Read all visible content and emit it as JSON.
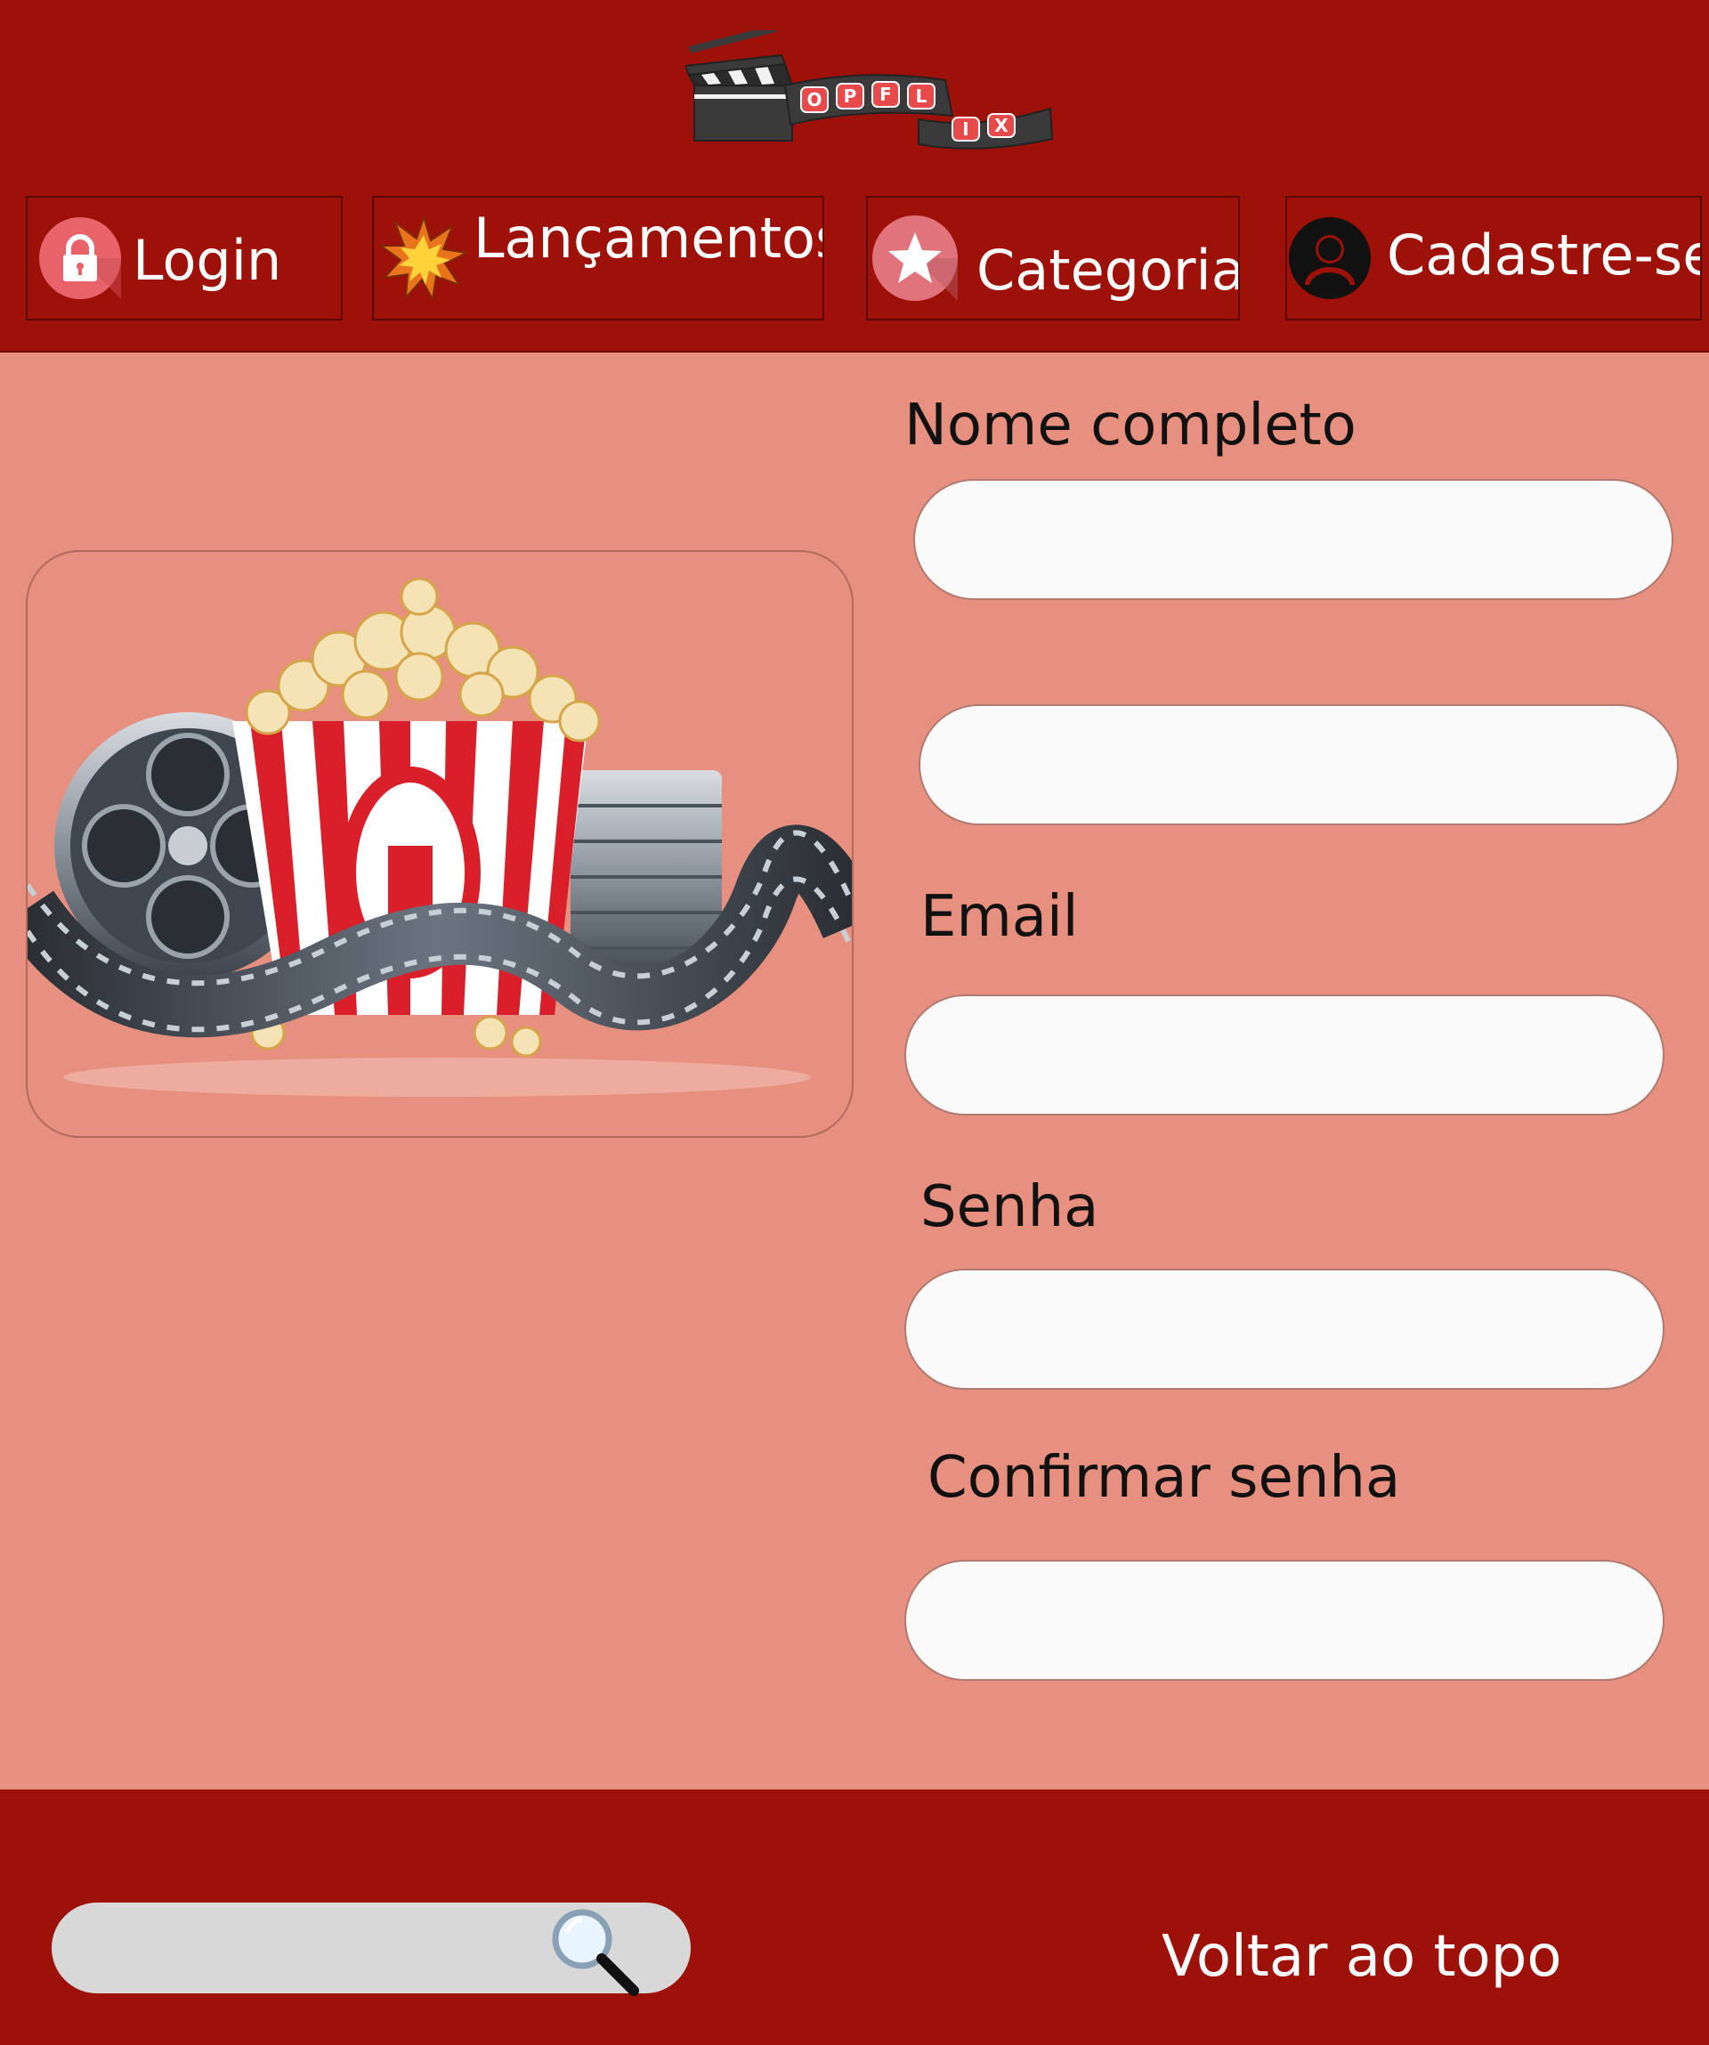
{
  "header": {
    "logo": {
      "top_letters": [
        "O",
        "P",
        "F",
        "L"
      ],
      "bottom_letters": [
        "I",
        "X"
      ]
    },
    "nav": [
      {
        "label": "Login",
        "icon": "lock-icon"
      },
      {
        "label": "Lançamentos",
        "icon": "explosion-icon"
      },
      {
        "label": "Categorias",
        "icon": "star-icon"
      },
      {
        "label": "Cadastre-se",
        "icon": "user-icon"
      }
    ]
  },
  "main": {
    "image": {
      "subject": "popcorn-film-reel-illustration"
    },
    "form": {
      "fields": [
        {
          "label": "Nome completo",
          "value": "",
          "placeholder": ""
        },
        {
          "label": "",
          "value": "",
          "placeholder": ""
        },
        {
          "label": "Email",
          "value": "",
          "placeholder": ""
        },
        {
          "label": "Senha",
          "value": "",
          "placeholder": ""
        },
        {
          "label": "Confirmar senha",
          "value": "",
          "placeholder": ""
        }
      ]
    }
  },
  "footer": {
    "search": {
      "value": "",
      "placeholder": "",
      "icon": "magnifier-icon"
    },
    "back_to_top": "Voltar ao topo"
  },
  "colors": {
    "header_bg": "#9e1108",
    "main_bg": "#e8907f",
    "input_bg": "#fafafa",
    "search_bg": "#d8d8d8",
    "text_light": "#ffffff",
    "text_dark": "#111111"
  }
}
